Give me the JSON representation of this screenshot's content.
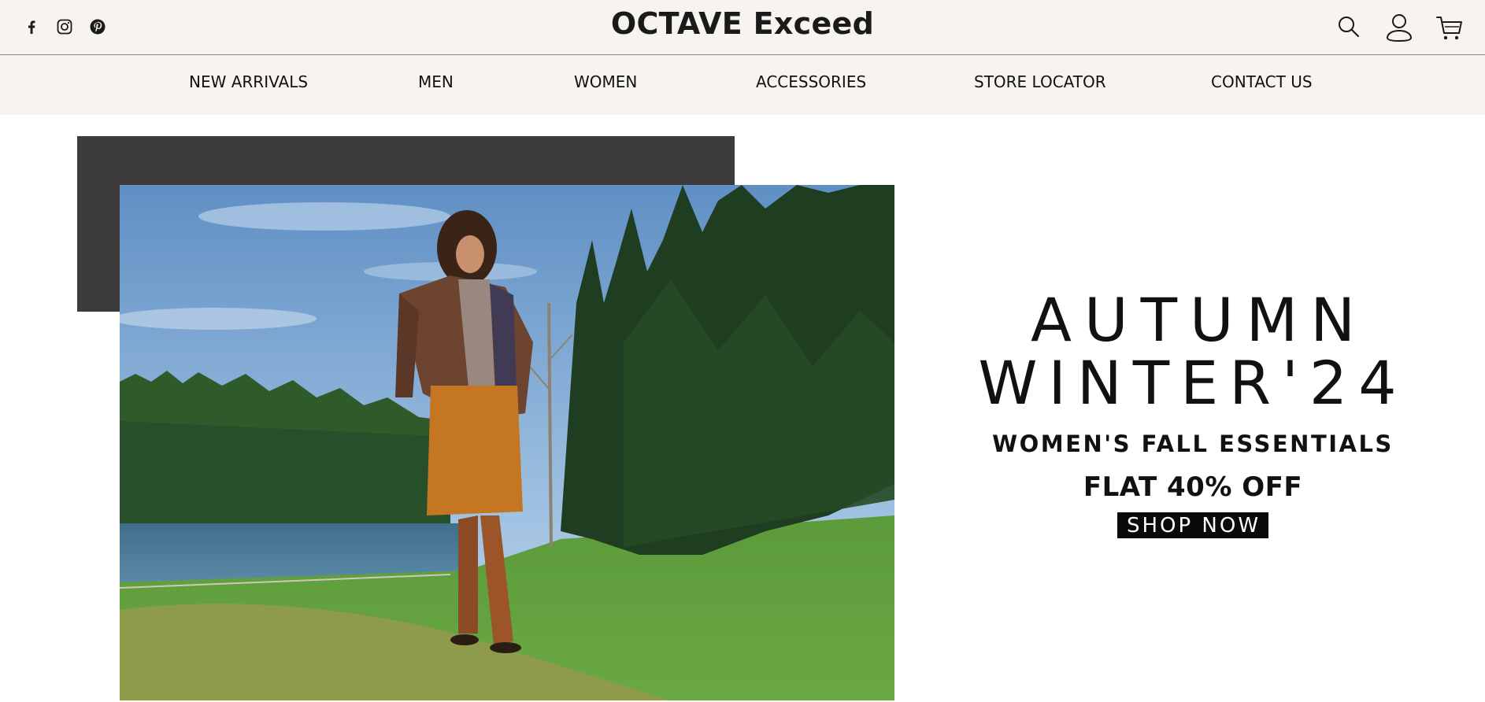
{
  "header": {
    "brand_main": "OCTAVE",
    "brand_sub": " Exceed",
    "social": [
      "facebook-icon",
      "instagram-icon",
      "pinterest-icon"
    ],
    "actions": [
      "search-icon",
      "account-icon",
      "cart-icon"
    ]
  },
  "nav": {
    "items": [
      {
        "label": "NEW ARRIVALS"
      },
      {
        "label": "MEN"
      },
      {
        "label": "WOMEN"
      },
      {
        "label": "ACCESSORIES"
      },
      {
        "label": "STORE LOCATOR"
      },
      {
        "label": "CONTACT US"
      }
    ]
  },
  "hero": {
    "line1": "AUTUMN",
    "line2": "WINTER'24",
    "line3": "WOMEN'S FALL ESSENTIALS",
    "line4": "FLAT 40% OFF",
    "cta": "SHOP NOW"
  },
  "colors": {
    "header_bg": "#f7f3ef",
    "accent_dark": "#3d3b3c",
    "cta_bg": "#0a0a0a",
    "text": "#111111"
  }
}
